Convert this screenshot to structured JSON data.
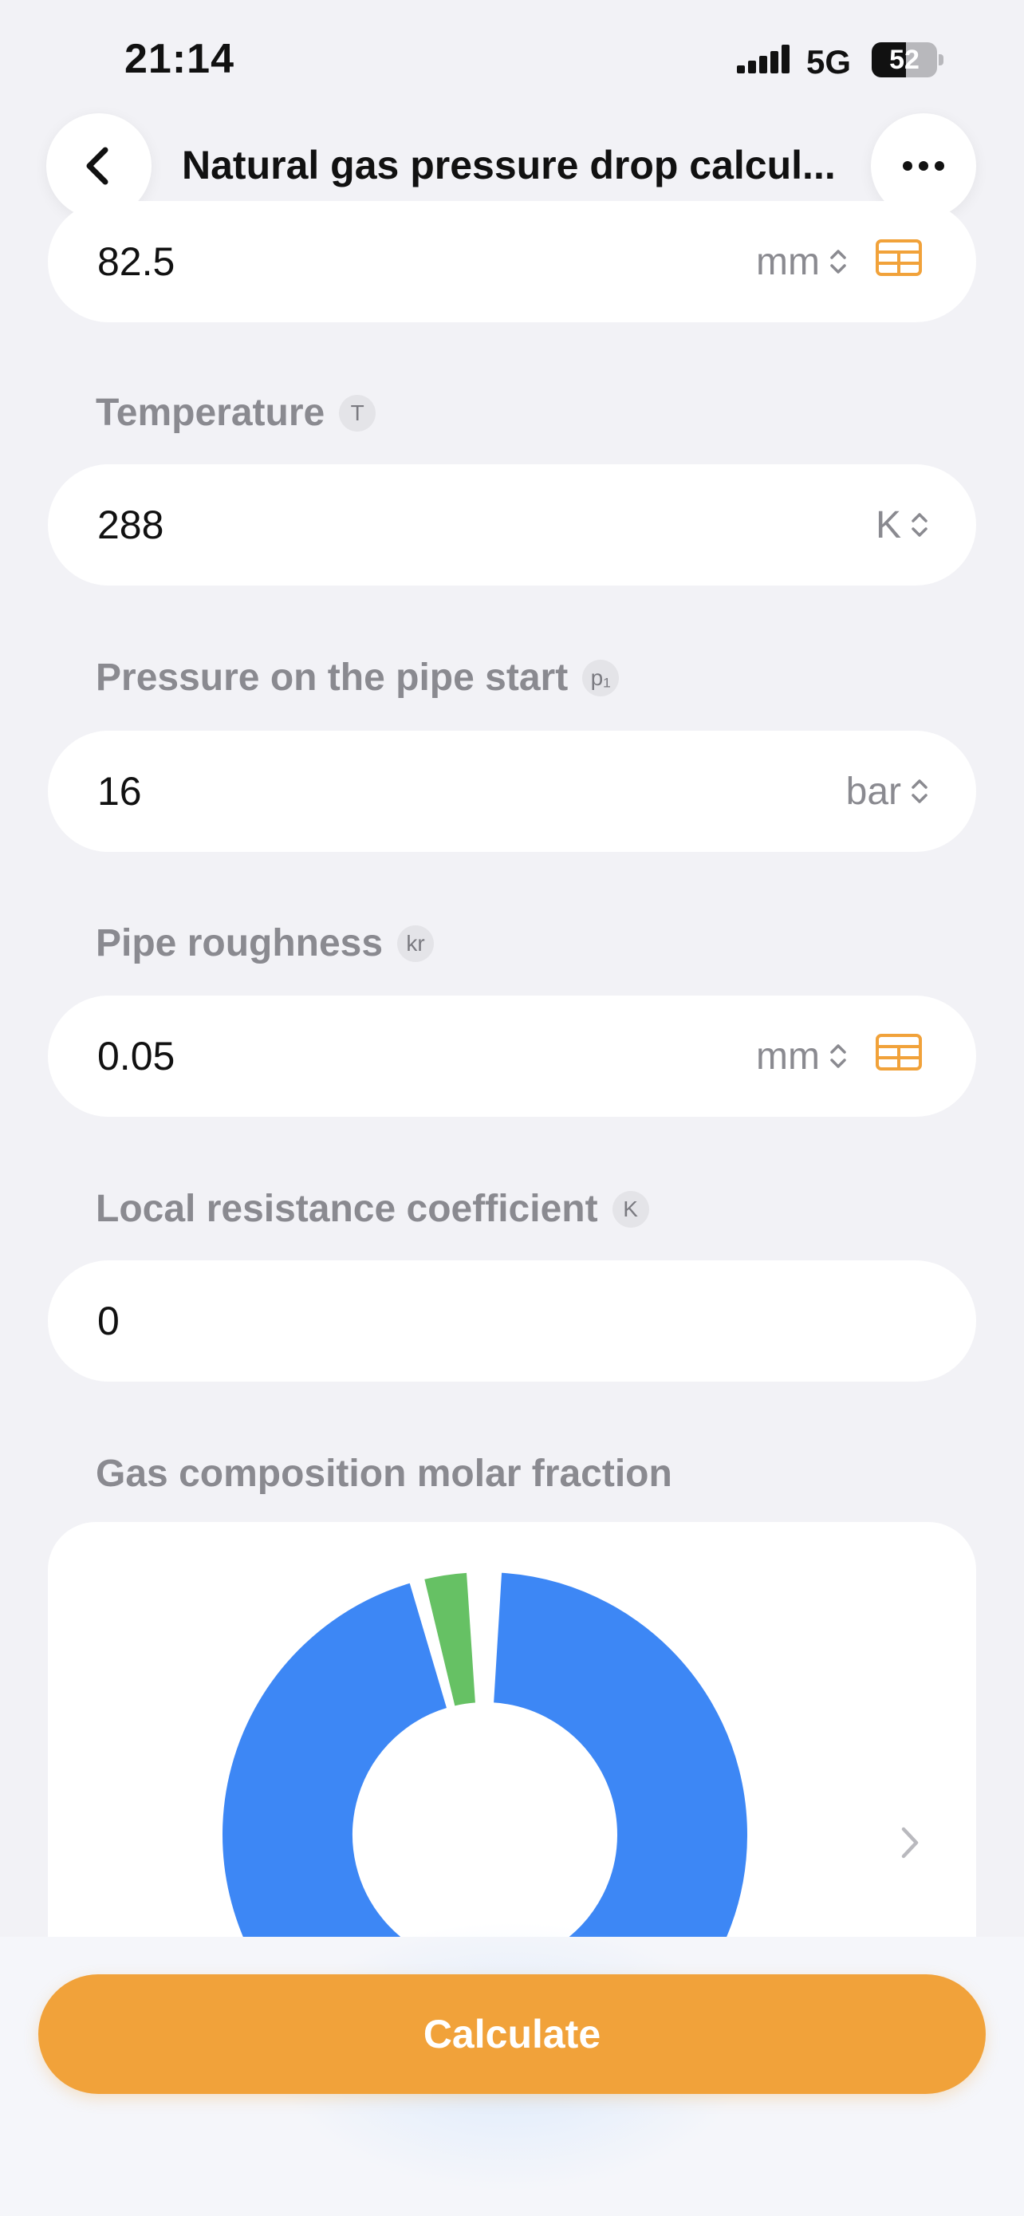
{
  "status_bar": {
    "time": "21:14",
    "network": "5G",
    "battery_percent": "52",
    "battery_level": 0.52
  },
  "nav": {
    "title": "Natural gas pressure drop calcul..."
  },
  "fields": [
    {
      "label": "",
      "symbol": "",
      "value": "82.5",
      "unit": "mm",
      "has_table": true
    },
    {
      "label": "Temperature",
      "symbol": "T",
      "value": "288",
      "unit": "K",
      "has_table": false
    },
    {
      "label": "Pressure on the pipe start",
      "symbol": "p₁",
      "value": "16",
      "unit": "bar",
      "has_table": false
    },
    {
      "label": "Pipe roughness",
      "symbol": "kr",
      "value": "0.05",
      "unit": "mm",
      "has_table": true
    },
    {
      "label": "Local resistance coefficient",
      "symbol": "K",
      "value": "0",
      "unit": "",
      "has_table": false
    }
  ],
  "gas_composition": {
    "label": "Gas composition molar fraction"
  },
  "colors": {
    "accent": "#f1a23a",
    "table_icon": "#f1a23a",
    "slice_main": "#3d87f5",
    "slice_second": "#66c164",
    "slice_third": "#f1a23a",
    "slice_fourth": "#f3d38f"
  },
  "chart_data": {
    "type": "pie",
    "values": [
      0.95,
      0.035,
      0.008,
      0.004
    ]
  },
  "actions": {
    "calculate_label": "Calculate"
  }
}
